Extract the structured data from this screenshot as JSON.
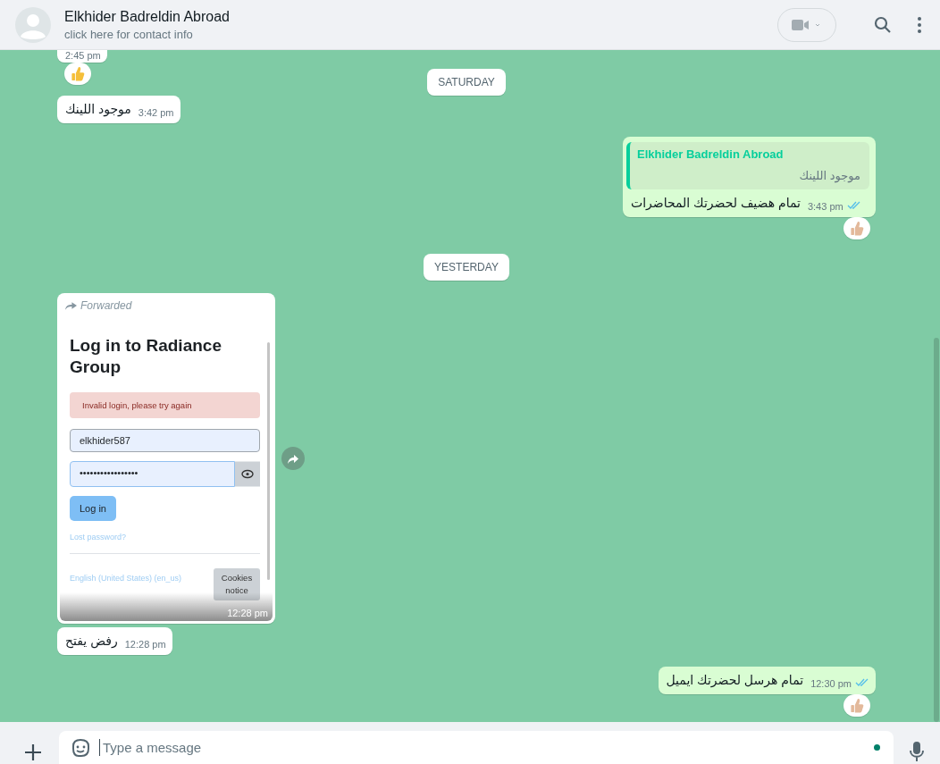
{
  "header": {
    "name": "Elkhider Badreldin Abroad",
    "subtitle": "click here for contact info"
  },
  "messages": [
    {
      "kind": "text",
      "outgoing": false,
      "time": "2:45 pm",
      "clipped": true,
      "reaction": {
        "color": "#f5bf3a"
      }
    },
    {
      "kind": "date",
      "text": "SATURDAY"
    },
    {
      "kind": "text",
      "outgoing": false,
      "text": "موجود اللينك",
      "time": "3:42 pm",
      "clipped": false
    },
    {
      "kind": "quote",
      "outgoing": true,
      "quote_author": "Elkhider Badreldin Abroad",
      "quote_text": "موجود اللينك",
      "text": "تمام هضيف لحضرتك المحاضرات",
      "time": "3:43 pm",
      "read": true,
      "reaction": {
        "color": "#e3b99b"
      }
    },
    {
      "kind": "date",
      "text": "YESTERDAY"
    },
    {
      "kind": "screenshot",
      "outgoing": false,
      "forwarded_label": "Forwarded",
      "time": "12:28 pm",
      "page": {
        "title": "Log in to Radiance Group",
        "alert": "Invalid login, please try again",
        "username": "elkhider587",
        "password": "•••••••••••••••••",
        "button": "Log in",
        "link": "Lost password?",
        "language": "English (United States) (en_us)",
        "cookies": "Cookies notice"
      }
    },
    {
      "kind": "text",
      "outgoing": false,
      "text": "رفض يفتح",
      "time": "12:28 pm",
      "clipped": false
    },
    {
      "kind": "text",
      "outgoing": true,
      "text": "تمام هرسل لحضرتك ايميل",
      "time": "12:30 pm",
      "read": true,
      "reaction": {
        "color": "#e3b99b"
      }
    }
  ],
  "composer": {
    "placeholder": "Type a message"
  }
}
